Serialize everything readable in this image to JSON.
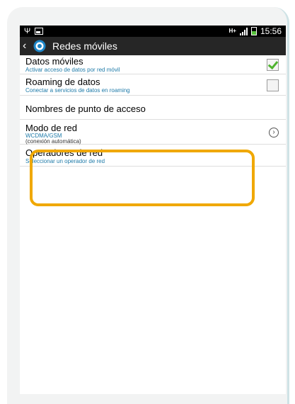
{
  "status_bar": {
    "network_type": "H+",
    "time": "15:56"
  },
  "action_bar": {
    "title": "Redes móviles"
  },
  "settings": [
    {
      "title": "Datos móviles",
      "subtitle": "Activar acceso de datos por red móvil",
      "control": "checkbox",
      "checked": true
    },
    {
      "title": "Roaming de datos",
      "subtitle": "Conectar a servicios de datos en roaming",
      "control": "checkbox",
      "checked": false
    },
    {
      "title": "Nombres de punto de acceso",
      "subtitle": "",
      "control": "none"
    },
    {
      "title": "Modo de red",
      "subtitle": "WCDMA/GSM",
      "subtitle2": "(conexión automática)",
      "control": "chevron"
    },
    {
      "title": "Operadores de red",
      "subtitle": "Seleccionar un operador de red",
      "control": "none"
    }
  ],
  "colors": {
    "highlight": "#f0a800",
    "subtitle_text": "#1e7aa8",
    "check_green": "#4fb32f"
  }
}
